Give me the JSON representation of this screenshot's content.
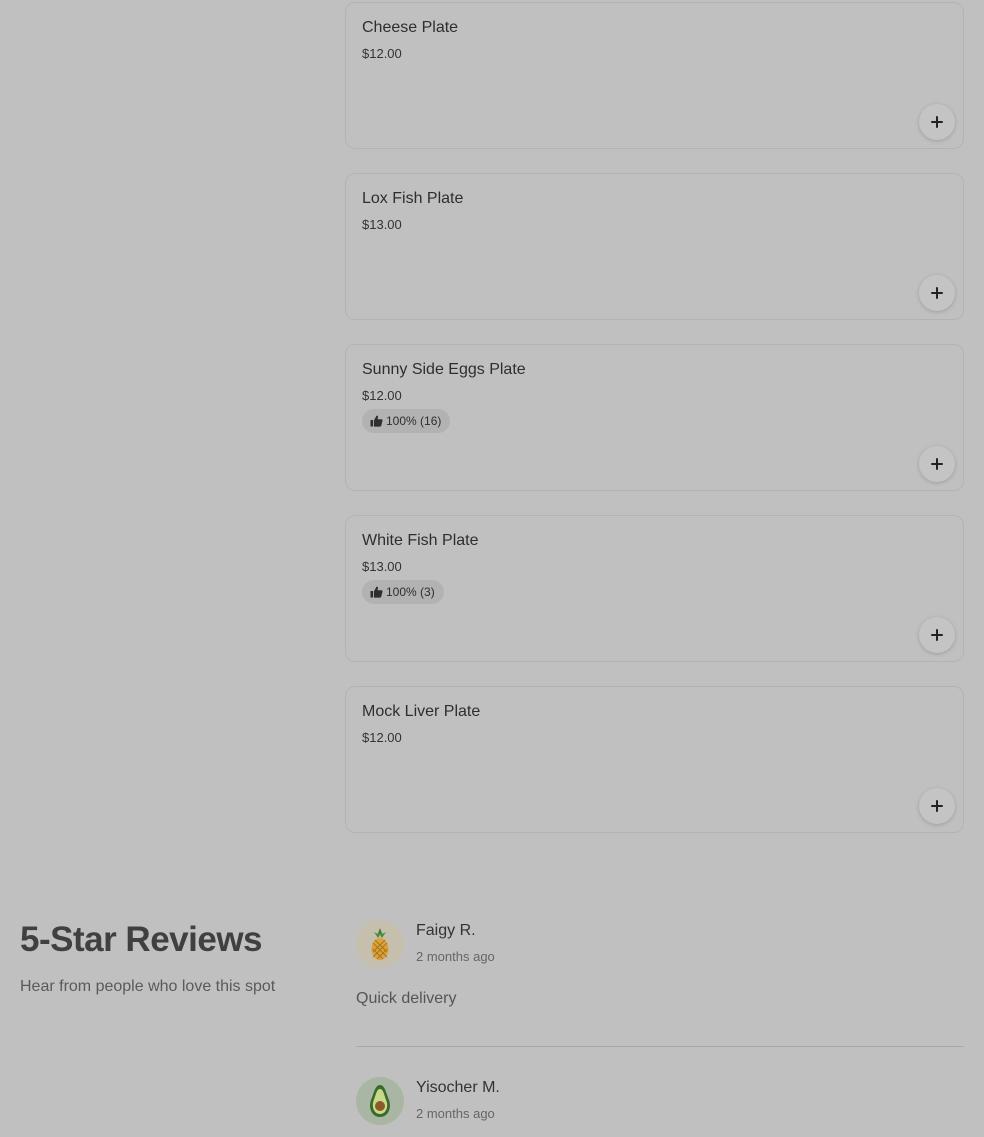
{
  "menu_items": [
    {
      "name": "Cheese Plate",
      "price": "$12.00"
    },
    {
      "name": "Lox Fish Plate",
      "price": "$13.00"
    },
    {
      "name": "Sunny Side Eggs Plate",
      "price": "$12.00",
      "rating": "100% (16)"
    },
    {
      "name": "White Fish Plate",
      "price": "$13.00",
      "rating": "100% (3)"
    },
    {
      "name": "Mock Liver Plate",
      "price": "$12.00"
    }
  ],
  "reviews_section": {
    "title": "5-Star Reviews",
    "subtitle": "Hear from people who love this spot"
  },
  "reviews": [
    {
      "name": "Faigy R.",
      "date": "2 months ago",
      "text": "Quick delivery",
      "avatar_icon": "pineapple-icon"
    },
    {
      "name": "Yisocher M.",
      "date": "2 months ago",
      "text": "",
      "avatar_icon": "avocado-icon"
    }
  ],
  "icons": {
    "add": "plus-icon",
    "rating": "thumbs-up-icon"
  },
  "colors": {
    "background": "#c0c0c0",
    "card_border": "#b3b3b3",
    "pill": "#b2b2b2"
  }
}
